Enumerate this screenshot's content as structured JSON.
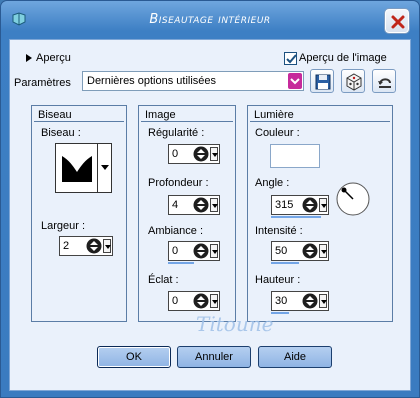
{
  "window": {
    "title": "Biseautage intérieur"
  },
  "preview_toggle": {
    "label": "Aperçu"
  },
  "show_preview": {
    "label": "Aperçu de l'image",
    "checked": true
  },
  "params": {
    "label": "Paramètres",
    "value": "Dernières options utilisées"
  },
  "groups": {
    "biseau": {
      "title": "Biseau",
      "bevel_label": "Biseau :",
      "width_label": "Largeur :",
      "width_value": "2"
    },
    "image": {
      "title": "Image",
      "smoothness_label": "Régularité :",
      "smoothness_value": "0",
      "depth_label": "Profondeur :",
      "depth_value": "4",
      "ambience_label": "Ambiance :",
      "ambience_value": "0",
      "shininess_label": "Éclat :",
      "shininess_value": "0"
    },
    "light": {
      "title": "Lumière",
      "color_label": "Couleur :",
      "angle_label": "Angle :",
      "angle_value": "315",
      "intensity_label": "Intensité :",
      "intensity_value": "50",
      "elevation_label": "Hauteur :",
      "elevation_value": "30"
    }
  },
  "buttons": {
    "ok": "OK",
    "cancel": "Annuler",
    "help": "Aide"
  },
  "watermark": "Titoune",
  "colors": {
    "title_bar": "#3d7fc4",
    "client": "#eaf1fb",
    "dropdown_accent": "#c62a9b",
    "light_color": "#ffffff"
  }
}
